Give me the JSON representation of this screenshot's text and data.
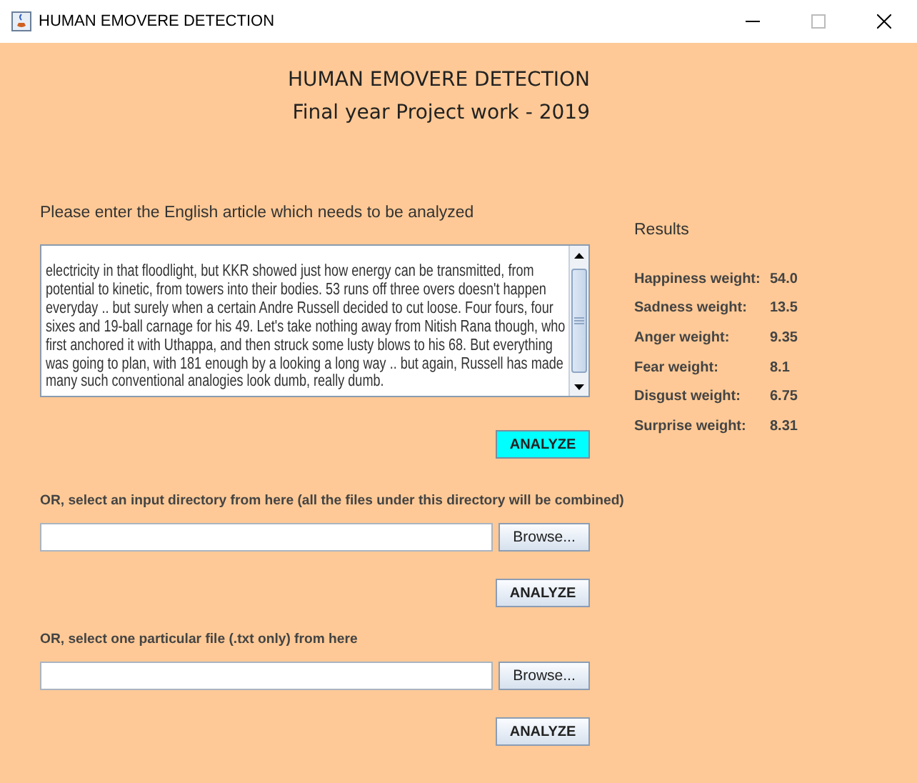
{
  "window": {
    "title": "HUMAN EMOVERE DETECTION"
  },
  "heading": {
    "title": "HUMAN EMOVERE DETECTION",
    "subtitle": "Final year Project work - 2019"
  },
  "article": {
    "label": "Please enter the English article which needs to be analyzed",
    "text": "electricity in that floodlight, but KKR showed just how energy can be transmitted, from\npotential to kinetic, from towers into their bodies. 53 runs off three overs doesn't happen\neveryday .. but surely when a certain Andre Russell decided to cut loose. Four fours, four\nsixes and 19-ball carnage for his 49. Let's take nothing away from Nitish Rana though, who\nfirst anchored it with Uthappa, and then struck some lusty blows to his 68. But everything\nwas going to plan, with 181 enough by a looking a long way .. but again, Russell has made\nmany such conventional analogies look dumb, really dumb.",
    "analyze": {
      "label": "ANALYZE",
      "highlighted": true
    }
  },
  "directory": {
    "label": "OR, select an input directory from here (all the files under this directory will be combined)",
    "browse": "Browse...",
    "analyze": {
      "label": "ANALYZE",
      "highlighted": false
    }
  },
  "file": {
    "label": "OR, select one particular file (.txt only) from here",
    "browse": "Browse...",
    "analyze": {
      "label": "ANALYZE",
      "highlighted": false
    }
  },
  "results": {
    "title": "Results",
    "rows": [
      {
        "label": "Happiness weight:",
        "value": "54.0"
      },
      {
        "label": "Sadness weight:",
        "value": "13.5"
      },
      {
        "label": "Anger weight:",
        "value": "9.35"
      },
      {
        "label": "Fear weight:",
        "value": "8.1"
      },
      {
        "label": "Disgust weight:",
        "value": "6.75"
      },
      {
        "label": "Surprise weight:",
        "value": "8.31"
      }
    ]
  }
}
